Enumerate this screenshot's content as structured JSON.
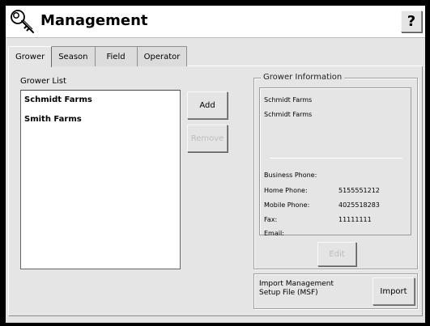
{
  "header": {
    "title": "Management",
    "help_label": "?",
    "app_icon": "key-icon"
  },
  "tabs": [
    {
      "label": "Grower",
      "active": true
    },
    {
      "label": "Season",
      "active": false
    },
    {
      "label": "Field",
      "active": false
    },
    {
      "label": "Operator",
      "active": false
    }
  ],
  "grower_list": {
    "label": "Grower List",
    "items": [
      "Schmidt Farms",
      "Smith Farms"
    ]
  },
  "buttons": {
    "add": "Add",
    "remove": "Remove",
    "edit": "Edit",
    "import": "Import"
  },
  "grower_info": {
    "legend": "Grower Information",
    "name_line1": "Schmidt Farms",
    "name_line2": "Schmidt Farms",
    "business_phone_label": "Business Phone:",
    "business_phone": "",
    "home_phone_label": "Home Phone:",
    "home_phone": "5155551212",
    "mobile_phone_label": "Mobile Phone:",
    "mobile_phone": "4025518283",
    "fax_label": "Fax:",
    "fax": "11111111",
    "email_label": "Email:",
    "email": ""
  },
  "import": {
    "line1": "Import Management",
    "line2": "Setup File (MSF)"
  }
}
